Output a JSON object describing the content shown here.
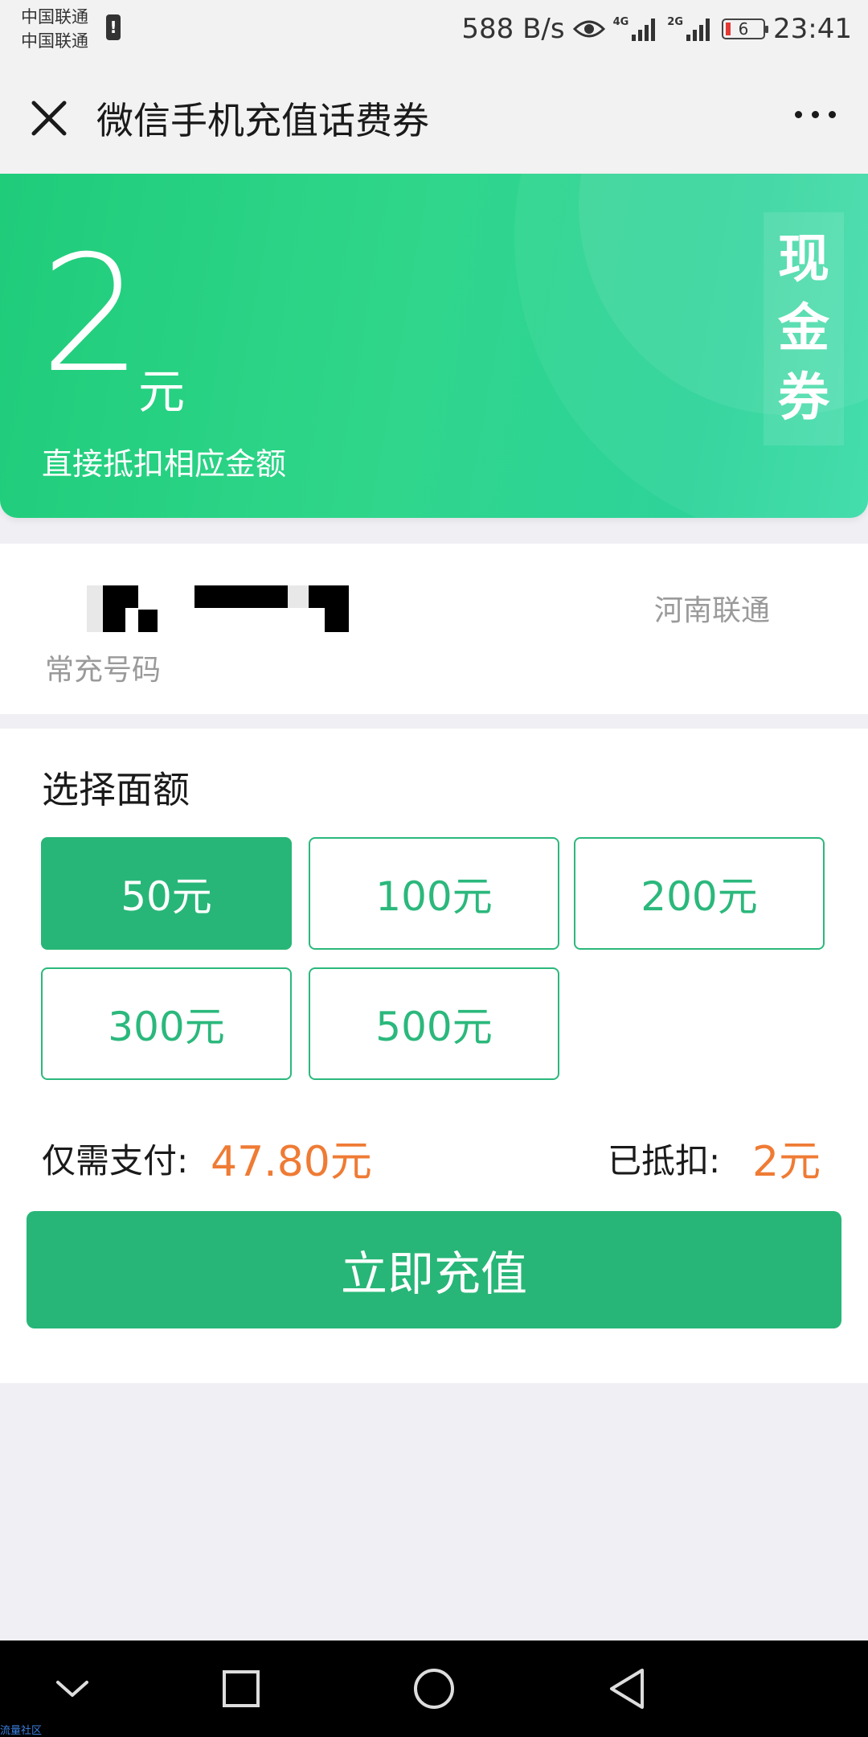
{
  "status_bar": {
    "carrier_1": "中国联通",
    "carrier_2": "中国联通",
    "net_speed": "588 B/s",
    "network_tag_1": "4G",
    "network_tag_2": "2G",
    "battery": "6",
    "time": "23:41"
  },
  "nav": {
    "title": "微信手机充值话费券",
    "close_icon": "close-icon",
    "more_icon": "more-icon"
  },
  "coupon": {
    "amount": "2",
    "unit": "元",
    "description": "直接抵扣相应金额",
    "tag_chars": [
      "现",
      "金",
      "券"
    ],
    "colors": {
      "start": "#1fcc7a",
      "end": "#3adca8"
    }
  },
  "phone": {
    "label": "常充号码",
    "carrier": "河南联通"
  },
  "denominations": {
    "title": "选择面额",
    "options": [
      "50元",
      "100元",
      "200元",
      "300元",
      "500元"
    ],
    "selected_index": 0
  },
  "payment": {
    "pay_label": "仅需支付:",
    "pay_value": "47.80元",
    "deduct_label": "已抵扣:",
    "deduct_value": "2元",
    "accent_color": "#ef7b34"
  },
  "action": {
    "recharge_label": "立即充值",
    "color": "#27b677"
  },
  "footer": {
    "watermark": "流量社区"
  }
}
